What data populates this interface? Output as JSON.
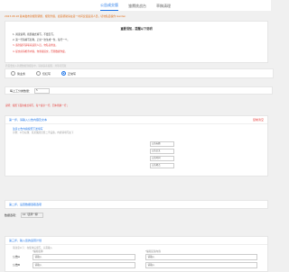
{
  "tabs": [
    "公告成交版",
    "雏鹰挑战台",
    "草稿清理"
  ],
  "notice": "2023.08.18 版本发布新规则调整，规则升级，如需帮助请在第一时间反馈运营人员，切勿私自操作 Garden",
  "rules": {
    "title": "重要须知，提醒以下说明",
    "lines": [
      "1. 阅读说明，按照格式填写，不要乱写。",
      "2. 第一行请填写名称，正常一次生成一条，每行一个。",
      "3. 遇到疑问请联系运营人员，勿私自修改。",
      "4. 提交前请检查内容，勿重复提交，否则数据作废。"
    ]
  },
  "faint_text": "若需要加入新增数据到报表中，请先联系客服，并等待回复",
  "radio": {
    "options": [
      "简业务",
      "仅红写",
      "正常写"
    ],
    "selected": 2
  },
  "label_row": {
    "label": "每上工分类数量：",
    "value": "5"
  },
  "step1": {
    "title": "第一步，请输入公告内容及文本",
    "right": "复制清空",
    "red_note": "说明：按照下面的格式填写，每个提示一行，回车则换一行；",
    "blue_note": "注意公告内容按照下述填写",
    "gray_note": "示例：公告标题：某某集团出售二手设备，内容请填写如下",
    "inputs": [
      "公告标题",
      "公告正文",
      "公告时间",
      "公告地点"
    ]
  },
  "step2": {
    "title": "第二步，设置数据选取选项"
  },
  "sp": {
    "label": "数据选项：",
    "value": "10（选择一些）"
  },
  "step3": {
    "title": "第三步，输入您的运营计划",
    "sub": "请注意以下：在使用后填写，只需输入",
    "col1": "*编辑名称",
    "col2": "*编辑实际内容",
    "rows": [
      {
        "label": "公告A",
        "ph1": "请输入",
        "ph2": "请输入"
      },
      {
        "label": "公告B",
        "ph1": "请输入",
        "ph2": "请输入"
      }
    ]
  }
}
